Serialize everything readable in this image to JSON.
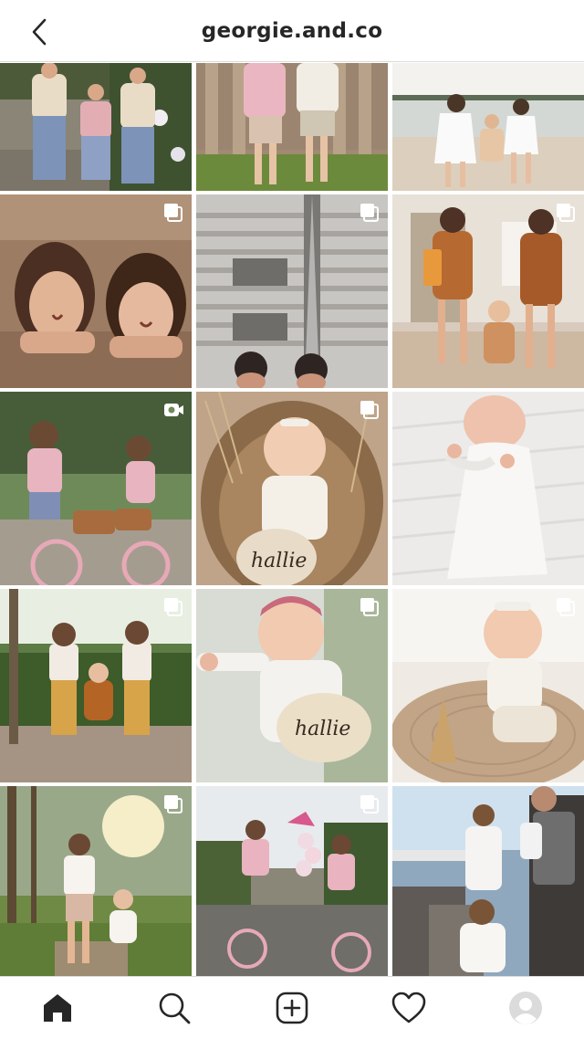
{
  "header": {
    "title": "georgie.and.co",
    "back_icon": "chevron-left-icon"
  },
  "grid": {
    "posts": [
      {
        "subject": "three kids in knit sweaters",
        "media": "image"
      },
      {
        "subject": "two kids by wooden fence",
        "media": "image"
      },
      {
        "subject": "kids on the beach",
        "media": "image"
      },
      {
        "subject": "two girls in the sea",
        "media": "carousel"
      },
      {
        "subject": "outdoor shower",
        "media": "carousel"
      },
      {
        "subject": "girls in leopard swimsuits",
        "media": "carousel"
      },
      {
        "subject": "girls on pink bikes",
        "media": "video"
      },
      {
        "subject": "baby in wicker chair with name plaque",
        "media": "carousel"
      },
      {
        "subject": "sleeping newborn",
        "media": "image"
      },
      {
        "subject": "three kids in the garden",
        "media": "carousel"
      },
      {
        "subject": "baby with pink headband and plaque",
        "media": "carousel"
      },
      {
        "subject": "baby on rattan rug",
        "media": "carousel"
      },
      {
        "subject": "kids in sunny forest",
        "media": "carousel"
      },
      {
        "subject": "girls on bikes with balloons",
        "media": "carousel"
      },
      {
        "subject": "family by the pier",
        "media": "image"
      }
    ]
  },
  "tabbar": {
    "items": [
      "home-icon",
      "search-icon",
      "new-post-icon",
      "activity-heart-icon",
      "profile-avatar-icon"
    ],
    "active": "home-icon"
  },
  "colors": {
    "text": "#262626",
    "divider": "#dbdbdb",
    "background": "#ffffff"
  }
}
